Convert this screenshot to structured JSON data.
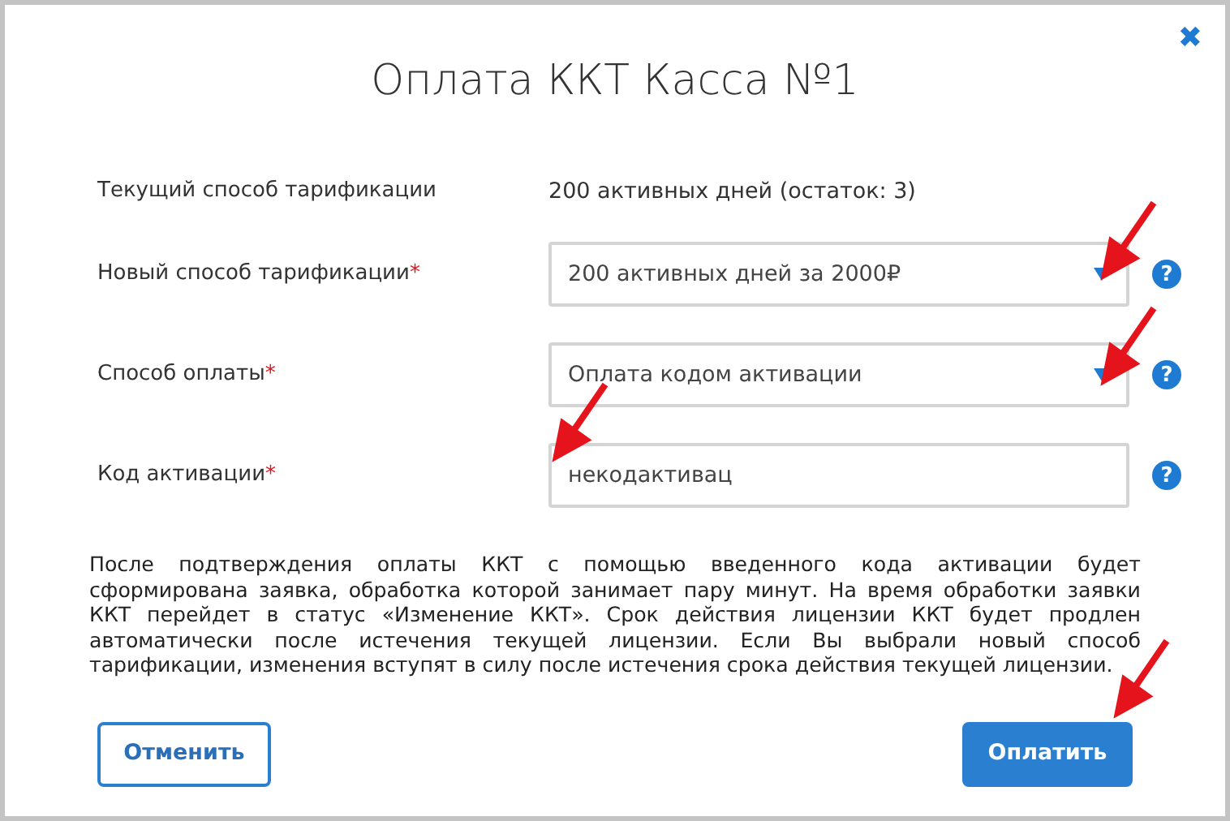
{
  "dialog": {
    "title": "Оплата ККТ Касса №1",
    "close": "✖"
  },
  "rows": [
    {
      "kind": "static",
      "label": "Текущий способ тарификации",
      "value": "200 активных дней (остаток: 3)"
    },
    {
      "kind": "select",
      "label": "Новый способ тарификации",
      "required_mark": "*",
      "value": "200 активных дней за 2000₽",
      "help": "?"
    },
    {
      "kind": "select",
      "label": "Способ оплаты",
      "required_mark": "*",
      "value": "Оплата кодом активации",
      "help": "?"
    },
    {
      "kind": "input",
      "label": "Код активации",
      "required_mark": "*",
      "value": "некодактивац",
      "help": "?"
    }
  ],
  "notice": "После подтверждения оплаты ККТ с помощью введенного кода активации будет сформирована заявка, обработка которой занимает пару минут. На время обработки заявки ККТ перейдет в статус «Изменение ККТ». Срок действия лицензии ККТ будет продлен автоматически после истечения текущей лицензии. Если Вы выбрали новый способ тарификации, изменения вступят в силу после истечения срока действия текущей лицензии.",
  "buttons": [
    {
      "kind": "secondary",
      "label": "Отменить"
    },
    {
      "kind": "primary",
      "label": "Оплатить"
    }
  ]
}
